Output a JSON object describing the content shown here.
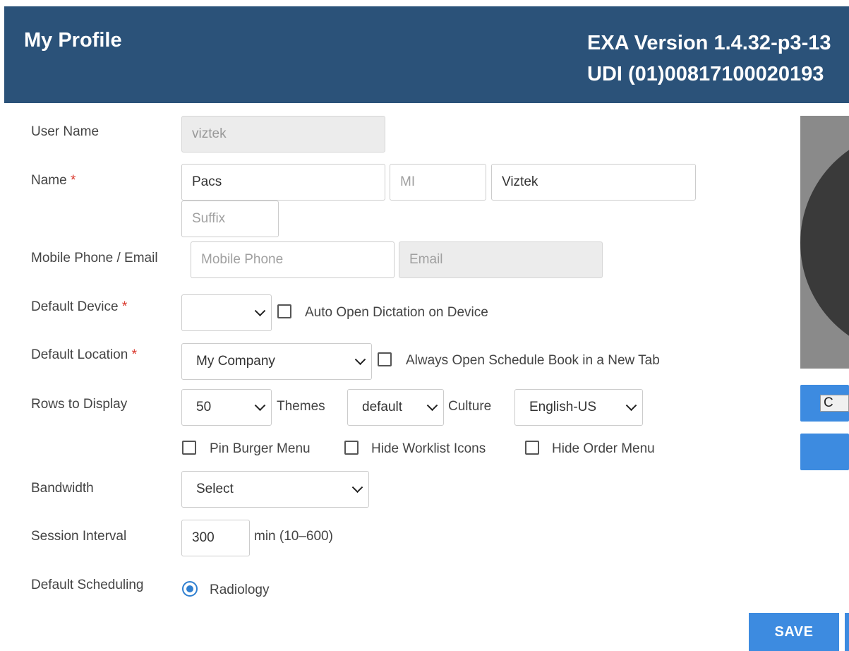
{
  "header": {
    "title": "My Profile",
    "version_line1": "EXA Version 1.4.32-p3-13",
    "version_line2": "UDI (01)00817100020193"
  },
  "form": {
    "username": {
      "label": "User Name",
      "value": "viztek"
    },
    "name": {
      "label": "Name",
      "required_mark": "*",
      "first": "Pacs",
      "mi_placeholder": "MI",
      "last": "Viztek",
      "suffix_placeholder": "Suffix"
    },
    "contact": {
      "label": "Mobile Phone / Email",
      "phone_placeholder": "Mobile Phone",
      "email_placeholder": "Email"
    },
    "default_device": {
      "label": "Default Device",
      "required_mark": "*",
      "value": "",
      "auto_open_label": "Auto Open Dictation on Device",
      "auto_open_checked": false
    },
    "default_location": {
      "label": "Default Location",
      "required_mark": "*",
      "value": "My Company",
      "always_open_label": "Always Open Schedule Book in a New Tab",
      "always_open_checked": false
    },
    "rows": {
      "label": "Rows to Display",
      "value": "50"
    },
    "themes": {
      "label": "Themes",
      "value": "default"
    },
    "culture": {
      "label": "Culture",
      "value": "English-US"
    },
    "options": {
      "pin_burger_label": "Pin Burger Menu",
      "hide_worklist_label": "Hide Worklist Icons",
      "hide_order_label": "Hide Order Menu"
    },
    "bandwidth": {
      "label": "Bandwidth",
      "value": "Select"
    },
    "session": {
      "label": "Session Interval",
      "value": "300",
      "hint": "min (10–600)"
    },
    "scheduling": {
      "label": "Default Scheduling",
      "option": "Radiology",
      "selected": true
    }
  },
  "side": {
    "choose_label": "C"
  },
  "actions": {
    "save_label": "SAVE"
  },
  "colors": {
    "header_bg": "#2b5279",
    "accent": "#3d8be0",
    "required": "#d9362b"
  }
}
